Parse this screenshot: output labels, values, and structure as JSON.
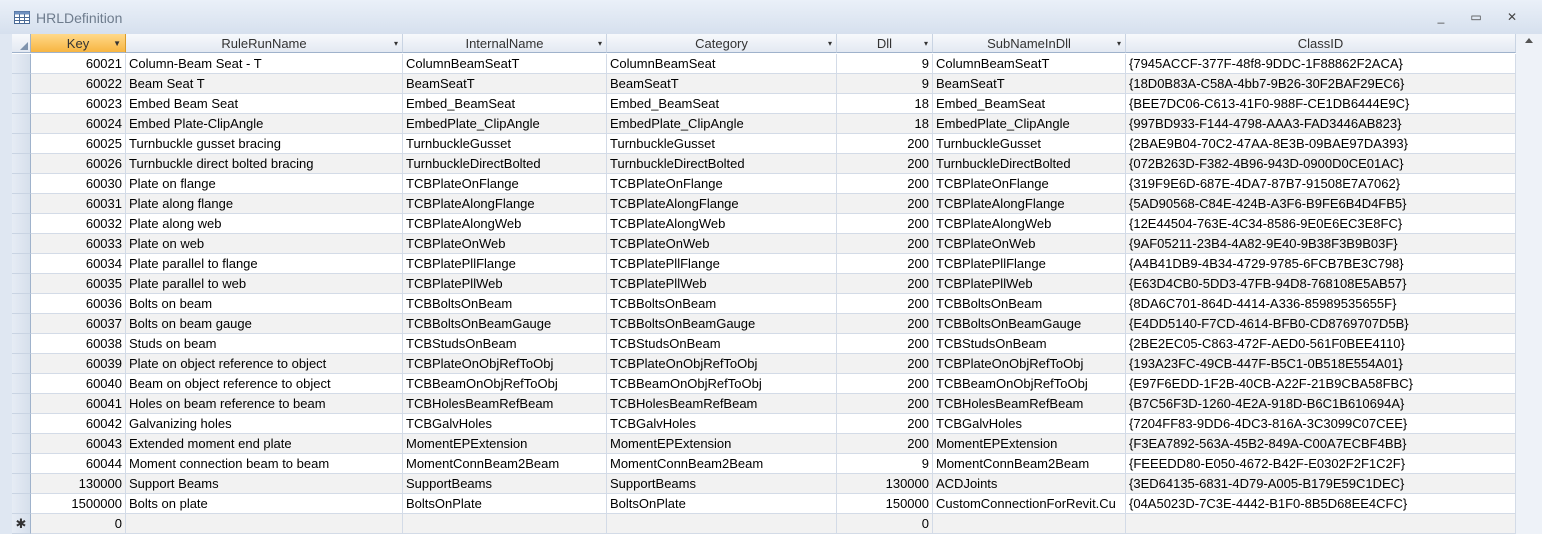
{
  "window": {
    "title": "HRLDefinition",
    "minimize": "_",
    "maximize": "▭",
    "close": "✕"
  },
  "columns": [
    {
      "key": "key",
      "label": "Key"
    },
    {
      "key": "rule",
      "label": "RuleRunName"
    },
    {
      "key": "internal",
      "label": "InternalName"
    },
    {
      "key": "category",
      "label": "Category"
    },
    {
      "key": "dll",
      "label": "Dll"
    },
    {
      "key": "subname",
      "label": "SubNameInDll"
    },
    {
      "key": "classid",
      "label": "ClassID"
    }
  ],
  "rows": [
    [
      "60021",
      "Column-Beam Seat - T",
      "ColumnBeamSeatT",
      "ColumnBeamSeat",
      "9",
      "ColumnBeamSeatT",
      "{7945ACCF-377F-48f8-9DDC-1F88862F2ACA}"
    ],
    [
      "60022",
      "Beam Seat T",
      "BeamSeatT",
      "BeamSeatT",
      "9",
      "BeamSeatT",
      "{18D0B83A-C58A-4bb7-9B26-30F2BAF29EC6}"
    ],
    [
      "60023",
      "Embed Beam Seat",
      "Embed_BeamSeat",
      "Embed_BeamSeat",
      "18",
      "Embed_BeamSeat",
      "{BEE7DC06-C613-41F0-988F-CE1DB6444E9C}"
    ],
    [
      "60024",
      "Embed Plate-ClipAngle",
      "EmbedPlate_ClipAngle",
      "EmbedPlate_ClipAngle",
      "18",
      "EmbedPlate_ClipAngle",
      "{997BD933-F144-4798-AAA3-FAD3446AB823}"
    ],
    [
      "60025",
      "Turnbuckle gusset bracing",
      "TurnbuckleGusset",
      "TurnbuckleGusset",
      "200",
      "TurnbuckleGusset",
      "{2BAE9B04-70C2-47AA-8E3B-09BAE97DA393}"
    ],
    [
      "60026",
      "Turnbuckle direct bolted bracing",
      "TurnbuckleDirectBolted",
      "TurnbuckleDirectBolted",
      "200",
      "TurnbuckleDirectBolted",
      "{072B263D-F382-4B96-943D-0900D0CE01AC}"
    ],
    [
      "60030",
      "Plate on flange",
      "TCBPlateOnFlange",
      "TCBPlateOnFlange",
      "200",
      "TCBPlateOnFlange",
      "{319F9E6D-687E-4DA7-87B7-91508E7A7062}"
    ],
    [
      "60031",
      "Plate along flange",
      "TCBPlateAlongFlange",
      "TCBPlateAlongFlange",
      "200",
      "TCBPlateAlongFlange",
      "{5AD90568-C84E-424B-A3F6-B9FE6B4D4FB5}"
    ],
    [
      "60032",
      "Plate along web",
      "TCBPlateAlongWeb",
      "TCBPlateAlongWeb",
      "200",
      "TCBPlateAlongWeb",
      "{12E44504-763E-4C34-8586-9E0E6EC3E8FC}"
    ],
    [
      "60033",
      "Plate on web",
      "TCBPlateOnWeb",
      "TCBPlateOnWeb",
      "200",
      "TCBPlateOnWeb",
      "{9AF05211-23B4-4A82-9E40-9B38F3B9B03F}"
    ],
    [
      "60034",
      "Plate parallel to flange",
      "TCBPlatePllFlange",
      "TCBPlatePllFlange",
      "200",
      "TCBPlatePllFlange",
      "{A4B41DB9-4B34-4729-9785-6FCB7BE3C798}"
    ],
    [
      "60035",
      "Plate parallel to web",
      "TCBPlatePllWeb",
      "TCBPlatePllWeb",
      "200",
      "TCBPlatePllWeb",
      "{E63D4CB0-5DD3-47FB-94D8-768108E5AB57}"
    ],
    [
      "60036",
      "Bolts on beam",
      "TCBBoltsOnBeam",
      "TCBBoltsOnBeam",
      "200",
      "TCBBoltsOnBeam",
      "{8DA6C701-864D-4414-A336-85989535655F}"
    ],
    [
      "60037",
      "Bolts on beam gauge",
      "TCBBoltsOnBeamGauge",
      "TCBBoltsOnBeamGauge",
      "200",
      "TCBBoltsOnBeamGauge",
      "{E4DD5140-F7CD-4614-BFB0-CD8769707D5B}"
    ],
    [
      "60038",
      "Studs on beam",
      "TCBStudsOnBeam",
      "TCBStudsOnBeam",
      "200",
      "TCBStudsOnBeam",
      "{2BE2EC05-C863-472F-AED0-561F0BEE4110}"
    ],
    [
      "60039",
      "Plate on object reference to object",
      "TCBPlateOnObjRefToObj",
      "TCBPlateOnObjRefToObj",
      "200",
      "TCBPlateOnObjRefToObj",
      "{193A23FC-49CB-447F-B5C1-0B518E554A01}"
    ],
    [
      "60040",
      "Beam on object reference to object",
      "TCBBeamOnObjRefToObj",
      "TCBBeamOnObjRefToObj",
      "200",
      "TCBBeamOnObjRefToObj",
      "{E97F6EDD-1F2B-40CB-A22F-21B9CBA58FBC}"
    ],
    [
      "60041",
      "Holes on beam reference to beam",
      "TCBHolesBeamRefBeam",
      "TCBHolesBeamRefBeam",
      "200",
      "TCBHolesBeamRefBeam",
      "{B7C56F3D-1260-4E2A-918D-B6C1B610694A}"
    ],
    [
      "60042",
      "Galvanizing holes",
      "TCBGalvHoles",
      "TCBGalvHoles",
      "200",
      "TCBGalvHoles",
      "{7204FF83-9DD6-4DC3-816A-3C3099C07CEE}"
    ],
    [
      "60043",
      "Extended moment end plate",
      "MomentEPExtension",
      "MomentEPExtension",
      "200",
      "MomentEPExtension",
      "{F3EA7892-563A-45B2-849A-C00A7ECBF4BB}"
    ],
    [
      "60044",
      "Moment connection beam to beam",
      "MomentConnBeam2Beam",
      "MomentConnBeam2Beam",
      "9",
      "MomentConnBeam2Beam",
      "{FEEEDD80-E050-4672-B42F-E0302F2F1C2F}"
    ],
    [
      "130000",
      "Support Beams",
      "SupportBeams",
      "SupportBeams",
      "130000",
      "ACDJoints",
      "{3ED64135-6831-4D79-A005-B179E59C1DEC}"
    ],
    [
      "1500000",
      "Bolts on plate",
      "BoltsOnPlate",
      "BoltsOnPlate",
      "150000",
      "CustomConnectionForRevit.Cu",
      "{04A5023D-7C3E-4442-B1F0-8B5D68EE4CFC}"
    ]
  ],
  "new_row": {
    "marker": "✱",
    "key": "0",
    "dll": "0"
  }
}
